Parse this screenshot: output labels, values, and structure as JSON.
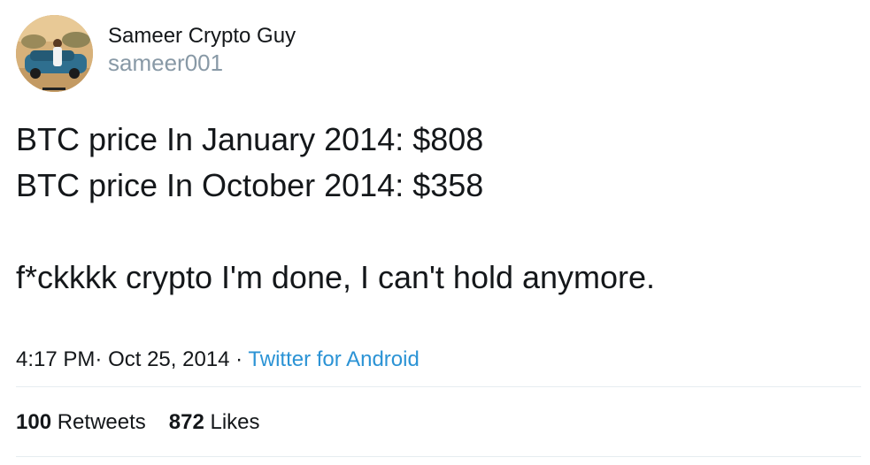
{
  "author": {
    "display_name": "Sameer Crypto Guy",
    "handle": "sameer001"
  },
  "tweet": {
    "lines": [
      "BTC price In January 2014: $808",
      "BTC price In October 2014: $358",
      "f*ckkkk crypto I'm done, I can't hold anymore."
    ],
    "time": "4:17 PM",
    "separator_1": "·",
    "date": "Oct 25, 2014",
    "separator_2": "·",
    "source": "Twitter for Android"
  },
  "stats": {
    "retweets_count": "100",
    "retweets_label": "Retweets",
    "likes_count": "872",
    "likes_label": "Likes"
  },
  "colors": {
    "text": "#14171a",
    "muted": "#8899a6",
    "link": "#2b93d5",
    "divider": "#e6ecf0"
  }
}
